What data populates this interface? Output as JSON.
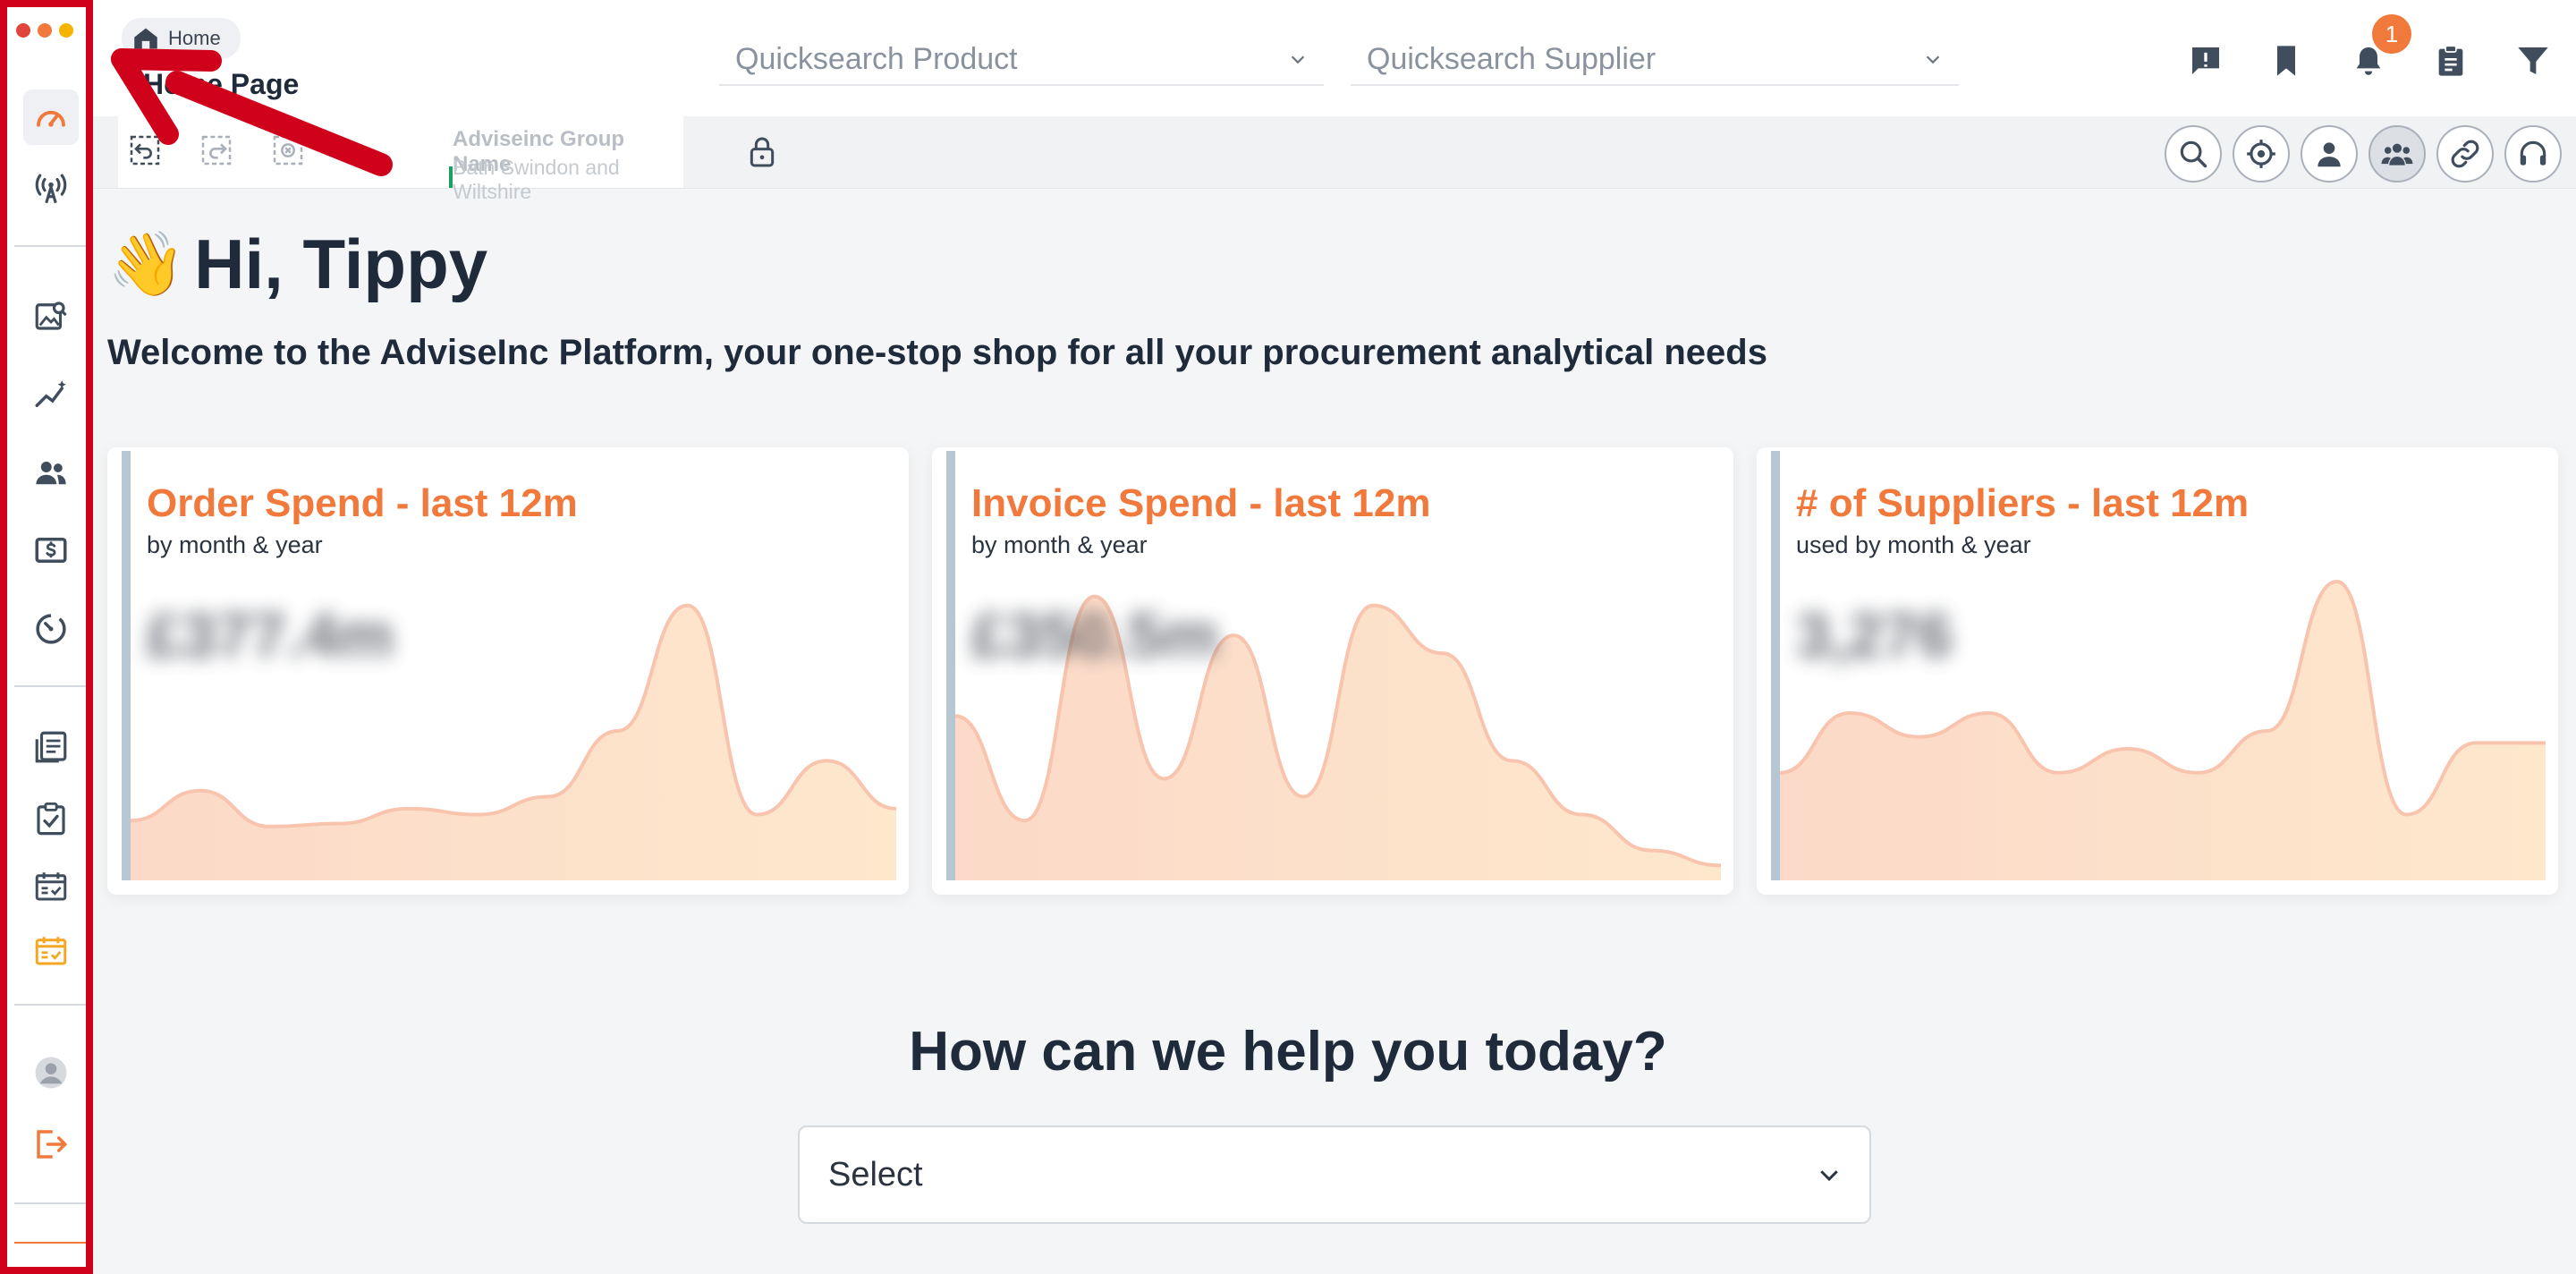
{
  "breadcrumb": {
    "label": "Home"
  },
  "page": {
    "title": "Home Page"
  },
  "search": {
    "product_placeholder": "Quicksearch Product",
    "supplier_placeholder": "Quicksearch Supplier"
  },
  "notifications": {
    "count": "1"
  },
  "group": {
    "label": "Adviseinc Group Name",
    "value": "Bath Swindon and Wiltshire"
  },
  "greeting": {
    "emoji": "👋",
    "text": "Hi, Tippy",
    "welcome": "Welcome to the AdviseInc Platform, your one-stop shop for all your procurement analytical needs"
  },
  "cards": [
    {
      "title": "Order Spend - last 12m",
      "subtitle": "by month & year",
      "value": "£377.4m"
    },
    {
      "title": "Invoice Spend - last 12m",
      "subtitle": "by month & year",
      "value": "£350.5m"
    },
    {
      "title": "# of Suppliers - last 12m",
      "subtitle": "used by month & year",
      "value": "3,276"
    }
  ],
  "help": {
    "heading": "How can we help you today?",
    "select_value": "Select"
  },
  "colors": {
    "accent": "#f0793b",
    "annotation": "#d0021b",
    "text": "#1f2b3a"
  },
  "chart_data": [
    {
      "type": "area",
      "title": "Order Spend - last 12m",
      "subtitle": "by month & year",
      "x": [
        1,
        2,
        3,
        4,
        5,
        6,
        7,
        8,
        9,
        10,
        11,
        12
      ],
      "values": [
        20,
        30,
        18,
        19,
        24,
        22,
        28,
        50,
        92,
        22,
        40,
        24
      ],
      "ylim": [
        0,
        100
      ]
    },
    {
      "type": "area",
      "title": "Invoice Spend - last 12m",
      "subtitle": "by month & year",
      "x": [
        1,
        2,
        3,
        4,
        5,
        6,
        7,
        8,
        9,
        10,
        11,
        12
      ],
      "values": [
        55,
        20,
        95,
        34,
        82,
        28,
        92,
        76,
        40,
        22,
        10,
        5
      ],
      "ylim": [
        0,
        100
      ]
    },
    {
      "type": "area",
      "title": "# of Suppliers - last 12m",
      "subtitle": "used by month & year",
      "x": [
        1,
        2,
        3,
        4,
        5,
        6,
        7,
        8,
        9,
        10,
        11,
        12
      ],
      "values": [
        36,
        56,
        48,
        56,
        36,
        44,
        36,
        50,
        100,
        22,
        46,
        46
      ],
      "ylim": [
        0,
        100
      ]
    }
  ]
}
